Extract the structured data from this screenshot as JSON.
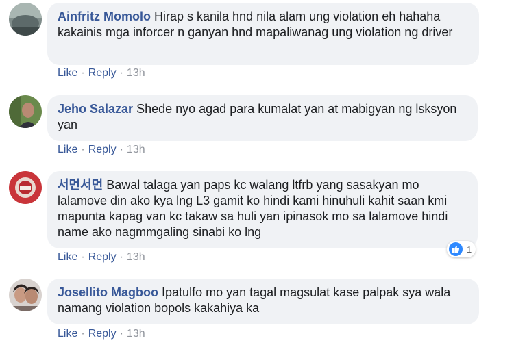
{
  "comments": [
    {
      "author": "Ainfritz Momolo",
      "text": "Hirap s kanila hnd nila alam ung violation eh hahaha kakainis mga inforcer n ganyan hnd mapaliwanag ung violation ng driver",
      "actions": {
        "like": "Like",
        "reply": "Reply",
        "time": "13h"
      }
    },
    {
      "author": "Jeho Salazar",
      "text": "Shede nyo agad para kumalat yan at mabigyan ng lsksyon yan",
      "actions": {
        "like": "Like",
        "reply": "Reply",
        "time": "13h"
      }
    },
    {
      "author": "서먼서먼",
      "text": "Bawal talaga yan paps kc walang ltfrb yang sasakyan mo lalamove din ako kya lng L3 gamit ko hindi kami hinuhuli kahit saan kmi mapunta kapag van kc takaw sa huli yan ipinasok mo sa lalamove hindi name ako nagmmgaling sinabi ko lng",
      "actions": {
        "like": "Like",
        "reply": "Reply",
        "time": "13h"
      },
      "reactions": {
        "count": "1",
        "icon": "thumbs-up-icon",
        "color": "#2e89ff"
      }
    },
    {
      "author": "Josellito Magboo",
      "text": "Ipatulfo mo yan tagal magsulat kase palpak sya wala namang violation bopols kakahiya ka",
      "actions": {
        "like": "Like",
        "reply": "Reply",
        "time": "13h"
      }
    }
  ],
  "colors": {
    "link": "#385898",
    "bubble": "#f0f2f5",
    "meta": "#90949c"
  }
}
